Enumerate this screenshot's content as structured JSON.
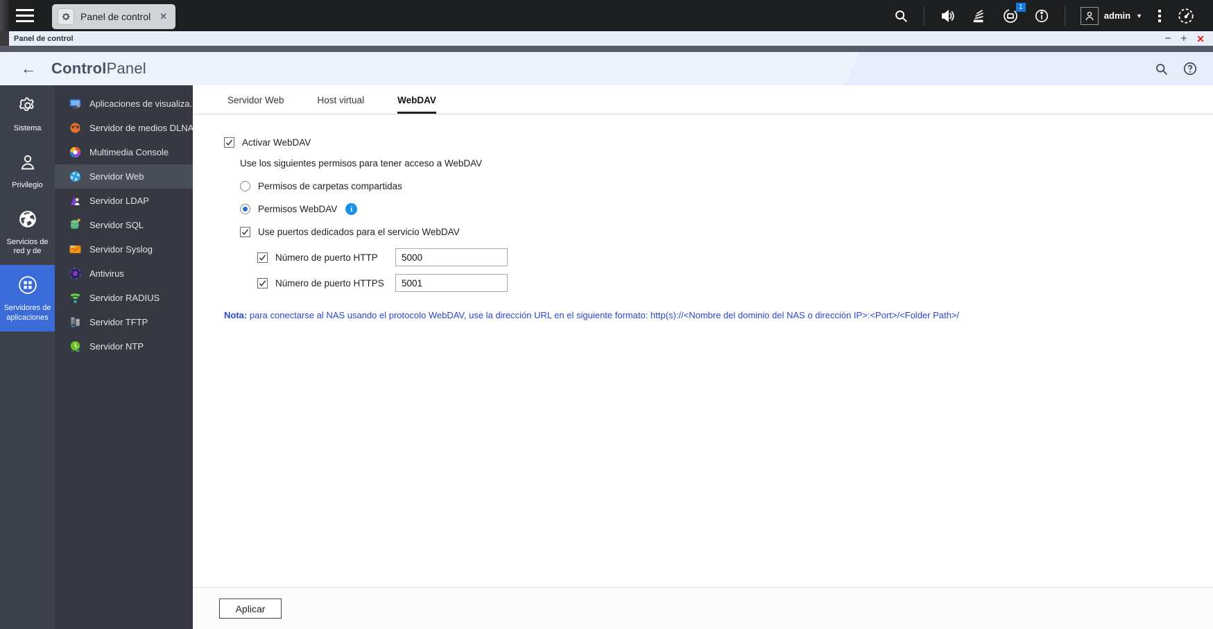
{
  "desktop": {
    "tab": {
      "label": "Panel de control"
    },
    "user": {
      "name": "admin",
      "notification_count": "1"
    }
  },
  "window": {
    "title": "Panel de control",
    "controls": {
      "minimize": "−",
      "maximize": "+",
      "close": "✕"
    }
  },
  "header": {
    "title_bold": "Control",
    "title_light": "Panel",
    "back_glyph": "←"
  },
  "nav_rail": {
    "items": [
      {
        "label": "Sistema",
        "icon": "gear-icon",
        "active": false
      },
      {
        "label": "Privilegio",
        "icon": "person-icon",
        "active": false
      },
      {
        "label": "Servicios de red y de",
        "icon": "globe-icon",
        "active": false
      },
      {
        "label": "Servidores de aplicaciones",
        "icon": "apps-circle-icon",
        "active": true
      }
    ]
  },
  "app_list": {
    "items": [
      {
        "label": "Aplicaciones de visualiza...",
        "icon": "monitor-icon",
        "selected": false
      },
      {
        "label": "Servidor de medios DLNA",
        "icon": "dlna-swirl-icon",
        "selected": false
      },
      {
        "label": "Multimedia Console",
        "icon": "multimedia-wheel-icon",
        "selected": false
      },
      {
        "label": "Servidor Web",
        "icon": "web-globe-icon",
        "selected": true
      },
      {
        "label": "Servidor LDAP",
        "icon": "ldap-icon",
        "selected": false
      },
      {
        "label": "Servidor SQL",
        "icon": "sql-database-icon",
        "selected": false
      },
      {
        "label": "Servidor Syslog",
        "icon": "syslog-envelope-icon",
        "selected": false
      },
      {
        "label": "Antivirus",
        "icon": "antivirus-icon",
        "selected": false
      },
      {
        "label": "Servidor RADIUS",
        "icon": "radius-icon",
        "selected": false
      },
      {
        "label": "Servidor TFTP",
        "icon": "tftp-server-icon",
        "selected": false
      },
      {
        "label": "Servidor NTP",
        "icon": "ntp-clock-icon",
        "selected": false
      }
    ]
  },
  "tabs": [
    {
      "label": "Servidor Web",
      "active": false
    },
    {
      "label": "Host virtual",
      "active": false
    },
    {
      "label": "WebDAV",
      "active": true
    }
  ],
  "form": {
    "enable_webdav": {
      "label": "Activar WebDAV",
      "checked": true
    },
    "permissions_intro": "Use los siguientes permisos para tener acceso a WebDAV",
    "radio_shared": {
      "label": "Permisos de carpetas compartidas",
      "selected": false
    },
    "radio_webdav": {
      "label": "Permisos WebDAV",
      "selected": true
    },
    "dedicated_ports": {
      "label": "Use puertos dedicados para el servicio WebDAV",
      "checked": true
    },
    "http_port": {
      "label": "Número de puerto HTTP",
      "value": "5000",
      "checked": true
    },
    "https_port": {
      "label": "Número de puerto HTTPS",
      "value": "5001",
      "checked": true
    },
    "note_bold": "Nota:",
    "note_rest": " para conectarse al NAS usando el protocolo WebDAV, use la dirección URL en el siguiente formato: http(s)://<Nombre del dominio del NAS o dirección IP>:<Port>/<Folder Path>/"
  },
  "footer": {
    "apply_label": "Aplicar"
  },
  "colors": {
    "accent_blue": "#3a6bd8",
    "badge_blue": "#1179e0",
    "note_blue": "#2a46cf",
    "close_red": "#e02020",
    "rail_bg": "#3d414b",
    "list_bg": "#363942"
  }
}
